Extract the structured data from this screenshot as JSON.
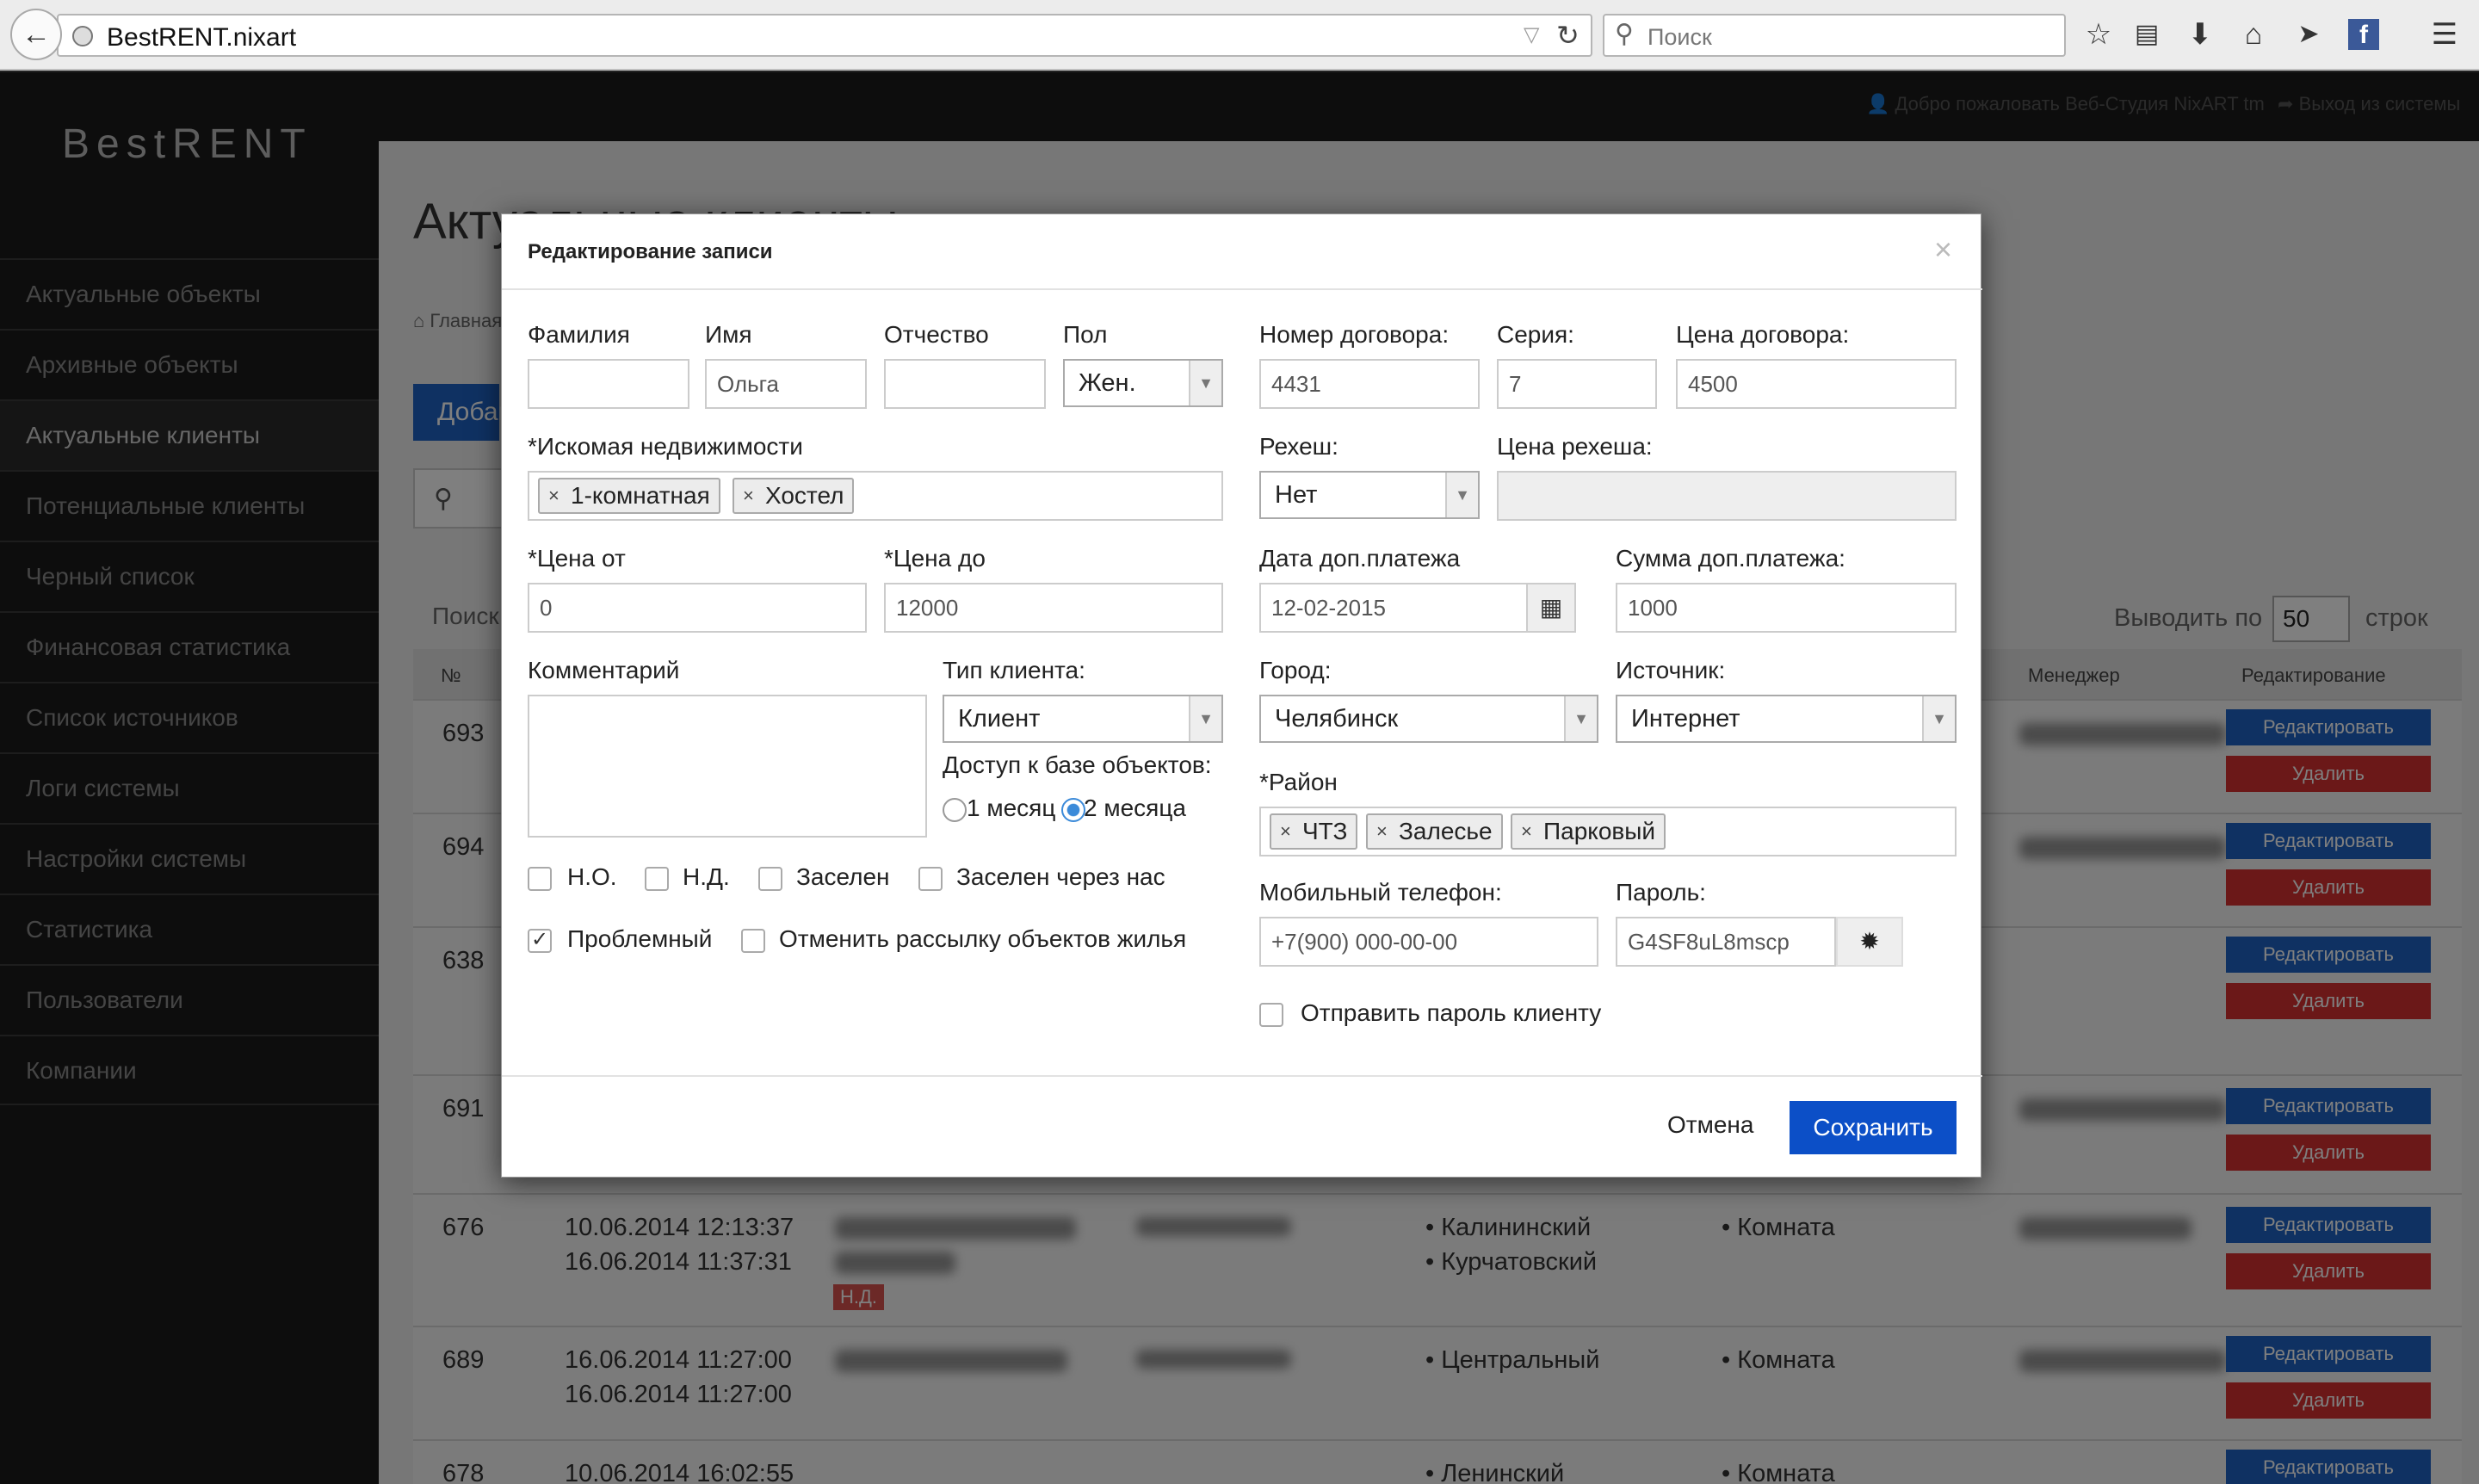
{
  "browser": {
    "url": "BestRENT.nixart",
    "search_placeholder": "Поиск"
  },
  "app": {
    "brand": "BestRENT",
    "welcome": "Добро пожаловать Веб-Студия NixART tm",
    "logout": "Выход из системы"
  },
  "sidebar": {
    "items": [
      {
        "label": "Актуальные объекты"
      },
      {
        "label": "Архивные объекты"
      },
      {
        "label": "Актуальные клиенты"
      },
      {
        "label": "Потенциальные клиенты"
      },
      {
        "label": "Черный список"
      },
      {
        "label": "Финансовая статистика"
      },
      {
        "label": "Список источников"
      },
      {
        "label": "Логи системы"
      },
      {
        "label": "Настройки системы"
      },
      {
        "label": "Статистика"
      },
      {
        "label": "Пользователи"
      },
      {
        "label": "Компании"
      }
    ]
  },
  "page": {
    "title": "Актуальные клиенты",
    "breadcrumb": "Главная",
    "add_button": "Добавить",
    "search_label": "Поиск:",
    "show_prefix": "Выводить по",
    "show_count": "50",
    "show_suffix": "строк"
  },
  "table": {
    "headers": {
      "num": "№",
      "manager": "Менеджер",
      "edit": "Редактирование"
    },
    "edit_label": "Редактировать",
    "delete_label": "Удалить",
    "nd_badge": "Н.Д.",
    "rows": [
      {
        "id": "693",
        "dates": [
          "",
          ""
        ],
        "districts": [],
        "types": []
      },
      {
        "id": "694",
        "dates": [
          "",
          ""
        ],
        "districts": [],
        "types": []
      },
      {
        "id": "638",
        "dates": [
          "",
          ""
        ],
        "districts": [],
        "types": []
      },
      {
        "id": "691",
        "dates": [
          "",
          ""
        ],
        "districts": [],
        "types": []
      },
      {
        "id": "676",
        "dates": [
          "10.06.2014 12:13:37",
          "16.06.2014 11:37:31"
        ],
        "districts": [
          "Калининский",
          "Курчатовский"
        ],
        "types": [
          "Комната"
        ]
      },
      {
        "id": "689",
        "dates": [
          "16.06.2014 11:27:00",
          "16.06.2014 11:27:00"
        ],
        "districts": [
          "Центральный"
        ],
        "types": [
          "Комната"
        ]
      },
      {
        "id": "678",
        "dates": [
          "10.06.2014 16:02:55",
          ""
        ],
        "districts": [
          "Ленинский"
        ],
        "types": [
          "Комната"
        ]
      }
    ]
  },
  "modal": {
    "title": "Редактирование записи",
    "close": "×",
    "fields": {
      "lastname_label": "Фамилия",
      "lastname_value": "",
      "firstname_label": "Имя",
      "firstname_value": "Ольга",
      "patronymic_label": "Отчество",
      "patronymic_value": "",
      "gender_label": "Пол",
      "gender_value": "Жен.",
      "contract_label": "Номер договора:",
      "contract_value": "4431",
      "series_label": "Серия:",
      "series_value": "7",
      "contract_price_label": "Цена договора:",
      "contract_price_value": "4500",
      "property_label": "*Искомая недвижимости",
      "property_tags": [
        "1-комнатная",
        "Хостел"
      ],
      "resale_label": "Рехеш:",
      "resale_value": "Нет",
      "resale_price_label": "Цена рехеша:",
      "resale_price_value": "",
      "price_from_label": "*Цена от",
      "price_from_value": "0",
      "price_to_label": "*Цена до",
      "price_to_value": "12000",
      "extra_date_label": "Дата доп.платежа",
      "extra_date_value": "12-02-2015",
      "extra_sum_label": "Сумма доп.платежа:",
      "extra_sum_value": "1000",
      "comment_label": "Комментарий",
      "comment_value": "",
      "client_type_label": "Тип клиента:",
      "client_type_value": "Клиент",
      "access_label": "Доступ к базе объектов:",
      "access_1": "1 месяц",
      "access_2": "2 месяца",
      "city_label": "Город:",
      "city_value": "Челябинск",
      "source_label": "Источник:",
      "source_value": "Интернет",
      "district_label": "*Район",
      "district_tags": [
        "ЧТЗ",
        "Залесье",
        "Парковый"
      ],
      "phone_label": "Мобильный телефон:",
      "phone_value": "+7(900) 000-00-00",
      "password_label": "Пароль:",
      "password_value": "G4SF8uL8mscp",
      "send_password_label": "Отправить пароль клиенту"
    },
    "checkboxes": {
      "no": "Н.О.",
      "nd": "Н.Д.",
      "settled": "Заселен",
      "settled_via": "Заселен через нас",
      "problem": "Проблемный",
      "cancel_mailing": "Отменить рассылку объектов жилья"
    },
    "buttons": {
      "cancel": "Отмена",
      "save": "Сохранить"
    }
  }
}
